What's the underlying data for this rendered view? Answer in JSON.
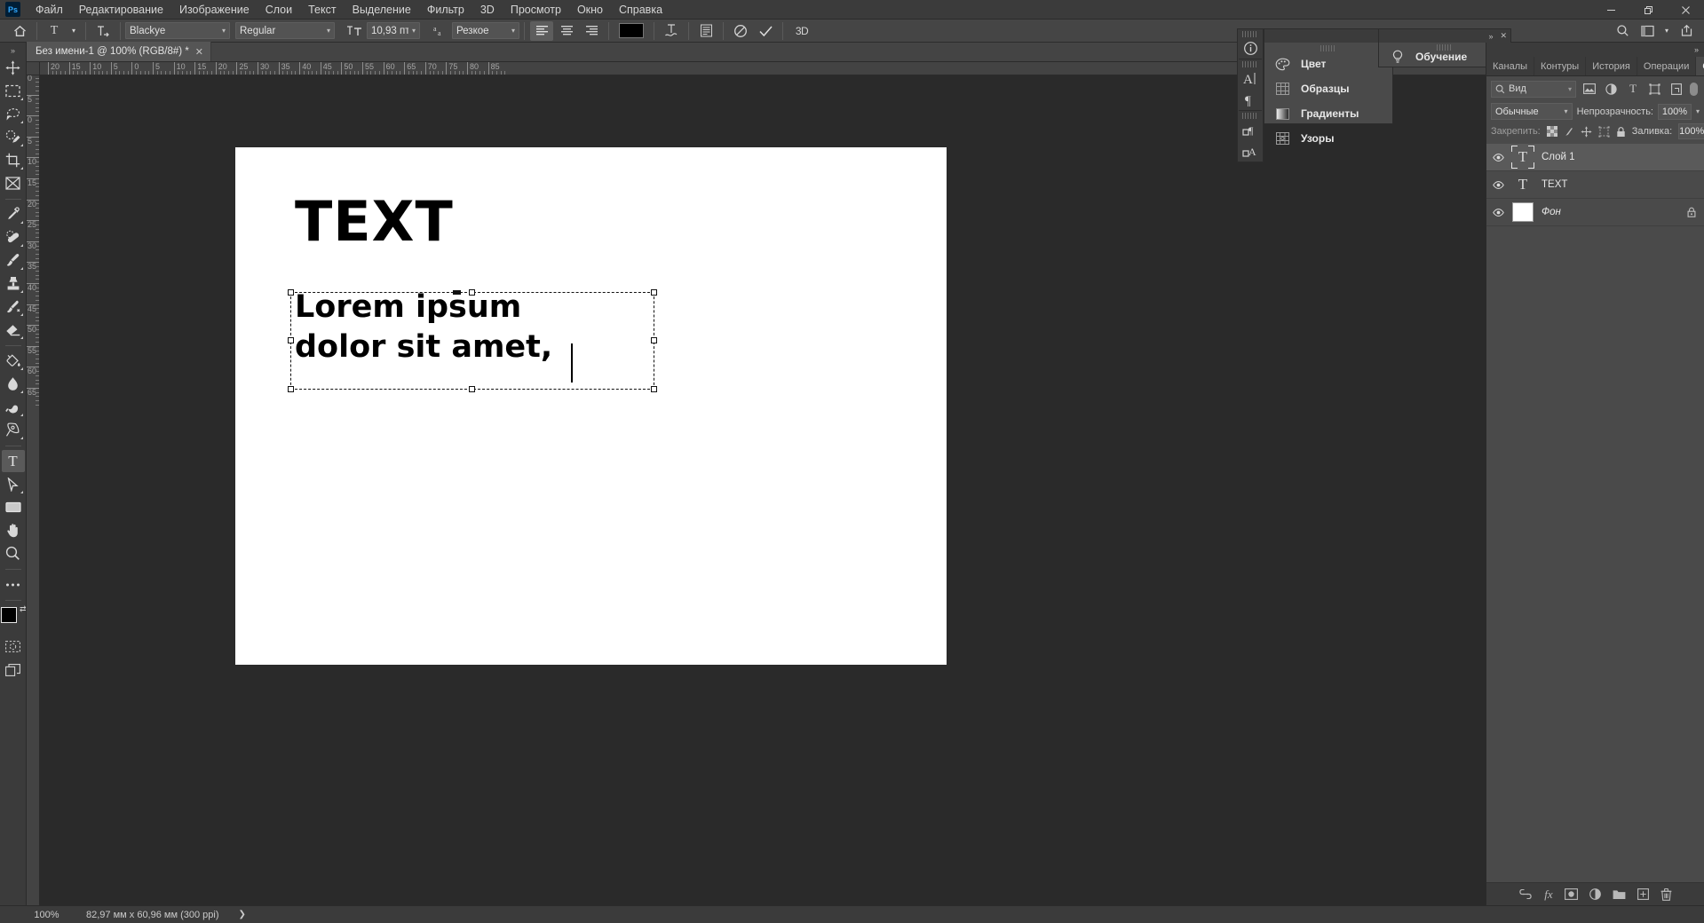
{
  "app": {
    "logo": "Ps"
  },
  "menubar": {
    "items": [
      "Файл",
      "Редактирование",
      "Изображение",
      "Слои",
      "Текст",
      "Выделение",
      "Фильтр",
      "3D",
      "Просмотр",
      "Окно",
      "Справка"
    ],
    "window_controls": {
      "minimize": "—",
      "maximize": "❐",
      "close": "✕"
    }
  },
  "options_bar": {
    "home_icon": "home-icon",
    "tool_preset": "T",
    "orientation_icon": "text-orientation-icon",
    "font_family": "Blackye",
    "font_style": "Regular",
    "font_size": "10,93 пт",
    "antialias_label": "aa",
    "antialias": "Резкое",
    "align": [
      "left",
      "center",
      "right"
    ],
    "align_selected": "left",
    "color_swatch": "#000000",
    "warp_icon": "warp-text-icon",
    "panels_icon": "character-paragraph-panels-icon",
    "cancel_icon": "cancel-icon",
    "commit_icon": "commit-icon",
    "three_d": "3D",
    "search_icon": "search-icon",
    "workspace_icon": "workspace-icon",
    "share_icon": "share-icon"
  },
  "toolbar": {
    "collapse": "»",
    "tools": [
      {
        "name": "move-tool",
        "glyph": "move"
      },
      {
        "name": "marquee-tool",
        "glyph": "marquee"
      },
      {
        "name": "lasso-tool",
        "glyph": "lasso"
      },
      {
        "name": "quick-selection-tool",
        "glyph": "quickselect"
      },
      {
        "name": "crop-tool",
        "glyph": "crop"
      },
      {
        "name": "frame-tool",
        "glyph": "frame"
      },
      {
        "name": "eyedropper-tool",
        "glyph": "eyedropper"
      },
      {
        "name": "healing-brush-tool",
        "glyph": "healing"
      },
      {
        "name": "brush-tool",
        "glyph": "brush"
      },
      {
        "name": "clone-stamp-tool",
        "glyph": "stamp"
      },
      {
        "name": "history-brush-tool",
        "glyph": "historybrush"
      },
      {
        "name": "eraser-tool",
        "glyph": "eraser"
      },
      {
        "name": "gradient-tool",
        "glyph": "bucket"
      },
      {
        "name": "blur-tool",
        "glyph": "blur"
      },
      {
        "name": "dodge-tool",
        "glyph": "dodge"
      },
      {
        "name": "pen-tool",
        "glyph": "pen"
      },
      {
        "name": "type-tool",
        "glyph": "type",
        "selected": true
      },
      {
        "name": "path-selection-tool",
        "glyph": "pathselect"
      },
      {
        "name": "rectangle-tool",
        "glyph": "rect"
      },
      {
        "name": "hand-tool",
        "glyph": "hand"
      },
      {
        "name": "zoom-tool",
        "glyph": "zoom"
      },
      {
        "name": "edit-toolbar-button",
        "glyph": "dots"
      }
    ],
    "foreground_color": "#000000",
    "background_color": "#f2d6d6",
    "quickmask_icon": "quick-mask-icon",
    "screenmode_icon": "screen-mode-icon"
  },
  "document": {
    "tab_title": "Без имени-1 @ 100% (RGB/8#) *",
    "close_glyph": "✕",
    "ruler_h_labels": [
      "20",
      "15",
      "10",
      "5",
      "0",
      "5",
      "10",
      "15",
      "20",
      "25",
      "30",
      "35",
      "40",
      "45",
      "50",
      "55",
      "60",
      "65",
      "70",
      "75",
      "80",
      "85"
    ],
    "ruler_v_labels": [
      "0",
      "5",
      "0",
      "5",
      "10",
      "15",
      "20",
      "25",
      "30",
      "35",
      "40",
      "45",
      "50",
      "55",
      "60",
      "65"
    ]
  },
  "canvas": {
    "heading_text": "TEXT",
    "body_line1": "Lorem ipsum",
    "body_line2": "dolor sit amet,"
  },
  "icon_dock": {
    "items": [
      {
        "name": "info-panel-icon",
        "glyph": "i"
      },
      {
        "name": "character-panel-icon",
        "glyph": "A|"
      },
      {
        "name": "paragraph-panel-icon",
        "glyph": "¶"
      },
      {
        "name": "paragraph-styles-panel-icon",
        "glyph": "p¶"
      },
      {
        "name": "character-styles-panel-icon",
        "glyph": "pA"
      }
    ]
  },
  "color_panel": {
    "chevron": "»",
    "rows": [
      {
        "icon": "color-palette-icon",
        "label": "Цвет"
      },
      {
        "icon": "swatches-grid-icon",
        "label": "Образцы"
      },
      {
        "icon": "gradients-icon",
        "label": "Градиенты"
      },
      {
        "icon": "patterns-icon",
        "label": "Узоры"
      }
    ]
  },
  "learn_panel": {
    "chevron": "»",
    "close": "✕",
    "icon": "lightbulb-icon",
    "label": "Обучение"
  },
  "layers_dock": {
    "collapse_chevron": "»",
    "close_glyph": "✕",
    "tabs": [
      {
        "label": "Каналы",
        "active": false
      },
      {
        "label": "Контуры",
        "active": false
      },
      {
        "label": "История",
        "active": false
      },
      {
        "label": "Операции",
        "active": false
      },
      {
        "label": "Слои",
        "active": true
      }
    ],
    "menu_icon": "panel-menu-icon",
    "filter": {
      "search_icon": "search-icon",
      "kind_label": "Вид",
      "icons": [
        "pixel-filter-icon",
        "adjustment-filter-icon",
        "type-filter-icon",
        "shape-filter-icon",
        "smartobject-filter-icon"
      ],
      "toggle": "filter-toggle"
    },
    "blend_mode": "Обычные",
    "opacity_label": "Непрозрачность:",
    "opacity_value": "100%",
    "lock_label": "Закрепить:",
    "lock_icons": [
      "lock-transparent-icon",
      "lock-image-icon",
      "lock-position-icon",
      "lock-artboard-icon",
      "lock-all-icon"
    ],
    "fill_label": "Заливка:",
    "fill_value": "100%",
    "layers": [
      {
        "name": "Слой 1",
        "type": "text",
        "selected": true,
        "visible": true,
        "locked": false
      },
      {
        "name": "TEXT",
        "type": "text",
        "selected": false,
        "visible": true,
        "locked": false
      },
      {
        "name": "Фон",
        "type": "background",
        "selected": false,
        "visible": true,
        "locked": true
      }
    ],
    "footer_icons": [
      "link-layers-icon",
      "layer-style-fx-icon",
      "layer-mask-icon",
      "adjustment-layer-icon",
      "new-group-icon",
      "new-layer-icon",
      "delete-layer-icon"
    ]
  },
  "status_bar": {
    "zoom": "100%",
    "doc_size": "82,97 мм x 60,96 мм (300 ppi)",
    "arrow": "❯"
  }
}
